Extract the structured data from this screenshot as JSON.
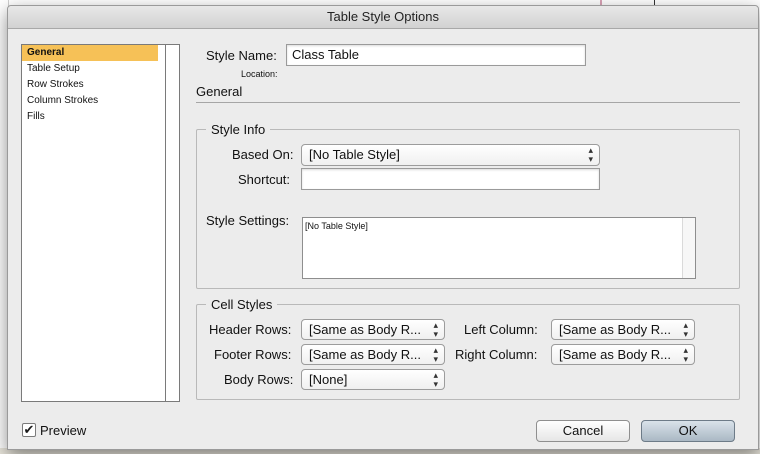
{
  "dialog": {
    "title": "Table Style Options"
  },
  "sidebar": {
    "items": [
      {
        "label": "General",
        "selected": true
      },
      {
        "label": "Table Setup",
        "selected": false
      },
      {
        "label": "Row Strokes",
        "selected": false
      },
      {
        "label": "Column Strokes",
        "selected": false
      },
      {
        "label": "Fills",
        "selected": false
      }
    ]
  },
  "header": {
    "style_name_label": "Style Name:",
    "style_name_value": "Class Table",
    "location_label": "Location:",
    "section_title": "General"
  },
  "style_info": {
    "title": "Style Info",
    "based_on_label": "Based On:",
    "based_on_value": "[No Table Style]",
    "shortcut_label": "Shortcut:",
    "shortcut_value": "",
    "settings_label": "Style Settings:",
    "settings_value": "[No Table Style]"
  },
  "cell_styles": {
    "title": "Cell Styles",
    "header_rows_label": "Header Rows:",
    "header_rows_value": "[Same as Body R...",
    "footer_rows_label": "Footer Rows:",
    "footer_rows_value": "[Same as Body R...",
    "body_rows_label": "Body Rows:",
    "body_rows_value": "[None]",
    "left_column_label": "Left Column:",
    "left_column_value": "[Same as Body R...",
    "right_column_label": "Right Column:",
    "right_column_value": "[Same as Body R..."
  },
  "footer": {
    "preview_label": "Preview",
    "preview_checked": true,
    "cancel_label": "Cancel",
    "ok_label": "OK"
  },
  "icons": {
    "select_arrows": "up-down-chevron-icon",
    "check": "checkmark-icon"
  }
}
